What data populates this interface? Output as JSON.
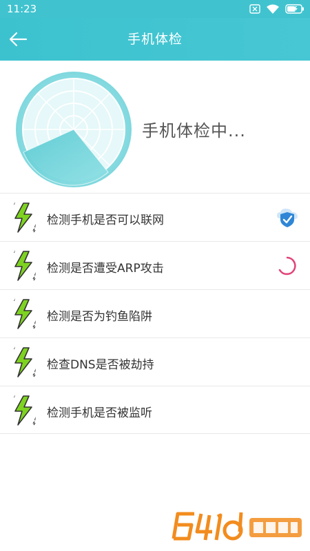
{
  "status_bar": {
    "time": "11:23",
    "icons": [
      "close-box-icon",
      "wifi-icon",
      "battery-icon"
    ]
  },
  "header": {
    "title": "手机体检",
    "back_icon": "arrow-left-icon"
  },
  "hero": {
    "status_text": "手机体检中..."
  },
  "checks": [
    {
      "label": "检测手机是否可以联网",
      "icon": "lightning-icon",
      "status": "done"
    },
    {
      "label": "检测是否遭受ARP攻击",
      "icon": "lightning-icon",
      "status": "loading"
    },
    {
      "label": "检测是否为钓鱼陷阱",
      "icon": "lightning-icon",
      "status": "pending"
    },
    {
      "label": "检查DNS是否被劫持",
      "icon": "lightning-icon",
      "status": "pending"
    },
    {
      "label": "检测手机是否被监听",
      "icon": "lightning-icon",
      "status": "pending"
    }
  ],
  "colors": {
    "primary": "#40c3cf",
    "lightning": "#7ed321",
    "spinner": "#e0447a",
    "shield": "#2f86d6"
  }
}
